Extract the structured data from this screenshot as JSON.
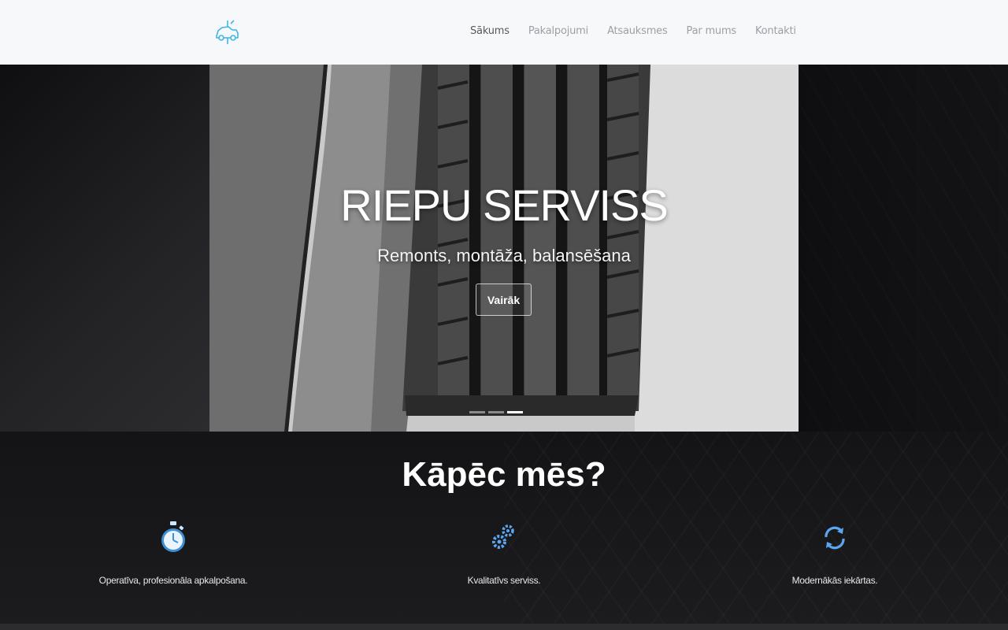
{
  "nav": {
    "logo_icon": "car-wrench-icon",
    "links": [
      {
        "label": "Sākums",
        "active": true
      },
      {
        "label": "Pakalpojumi",
        "active": false
      },
      {
        "label": "Atsauksmes",
        "active": false
      },
      {
        "label": "Par mums",
        "active": false
      },
      {
        "label": "Kontakti",
        "active": false
      }
    ]
  },
  "hero": {
    "title": "RIEPU SERVISS",
    "subtitle": "Remonts, montāža, balansēšana",
    "button_label": "Vairāk",
    "slides": 3,
    "active_slide": 2
  },
  "why": {
    "title": "Kāpēc mēs?",
    "features": [
      {
        "icon": "stopwatch-icon",
        "text": "Operatīva, profesionāla apkalpošana."
      },
      {
        "icon": "gears-icon",
        "text": "Kvalitatīvs serviss."
      },
      {
        "icon": "refresh-icon",
        "text": "Modernākās iekārtas."
      }
    ]
  },
  "colors": {
    "accent": "#3fb6e6",
    "nav_bg": "#f7f8fa"
  }
}
